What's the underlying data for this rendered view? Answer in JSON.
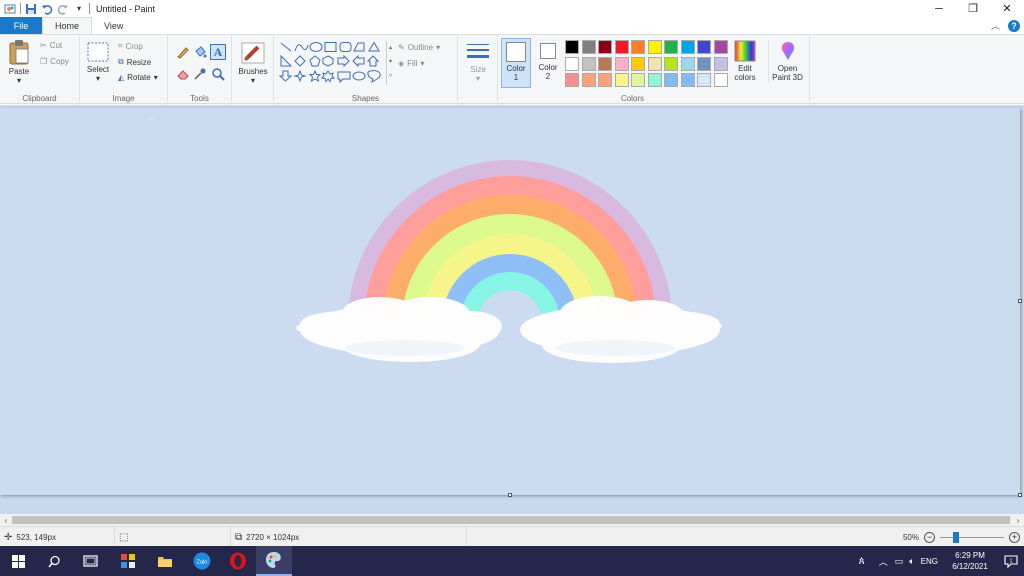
{
  "window": {
    "title": "Untitled - Paint",
    "controls": {
      "minimize": "─",
      "restore": "❐",
      "close": "✕"
    }
  },
  "tabs": {
    "file": "File",
    "home": "Home",
    "view": "View"
  },
  "ribbon": {
    "clipboard": {
      "label": "Clipboard",
      "paste": "Paste",
      "cut": "Cut",
      "copy": "Copy"
    },
    "image": {
      "label": "Image",
      "select": "Select",
      "crop": "Crop",
      "resize": "Resize",
      "rotate": "Rotate"
    },
    "tools": {
      "label": "Tools"
    },
    "brushes": {
      "label": "Brushes"
    },
    "shapes": {
      "label": "Shapes",
      "outline": "Outline",
      "fill": "Fill"
    },
    "size": {
      "label": "Size"
    },
    "colors": {
      "label": "Colors",
      "color1": "Color\n1",
      "color1_a": "Color",
      "color1_b": "1",
      "color2_a": "Color",
      "color2_b": "2",
      "edit_a": "Edit",
      "edit_b": "colors",
      "paint3d_a": "Open",
      "paint3d_b": "Paint 3D",
      "palette_row1": [
        "#000000",
        "#7f7f7f",
        "#880015",
        "#ed1c24",
        "#ff7f27",
        "#fff200",
        "#22b14c",
        "#00a2e8",
        "#3f48cc",
        "#a349a4"
      ],
      "palette_row2": [
        "#ffffff",
        "#c3c3c3",
        "#b97a57",
        "#ffaec9",
        "#ffc90e",
        "#efe4b0",
        "#b5e61d",
        "#99d9ea",
        "#7092be",
        "#c8bfe7"
      ],
      "palette_row3": [
        "#f69090",
        "#f9a27b",
        "#f9a27b",
        "#fbf48f",
        "#dff69d",
        "#8ff5d6",
        "#83b9f5",
        "#83b9f5",
        "#d9e6f9",
        "#ffffff"
      ]
    }
  },
  "status": {
    "cursor": "523, 149px",
    "image_size": "2720 × 1024px",
    "zoom": "50%",
    "zoom_level": 0.5
  },
  "taskbar": {
    "time": "6:29 PM",
    "date": "6/12/2021",
    "lang": "ENG"
  },
  "colors": {
    "accent": "#1979ca",
    "canvas_bg": "#cbdcf1",
    "rainbow": [
      "#d8b9e0",
      "#ff9e9a",
      "#ffad6b",
      "#dbf98c",
      "#f5f58a",
      "#8ec0f7",
      "#86f5e6"
    ]
  }
}
